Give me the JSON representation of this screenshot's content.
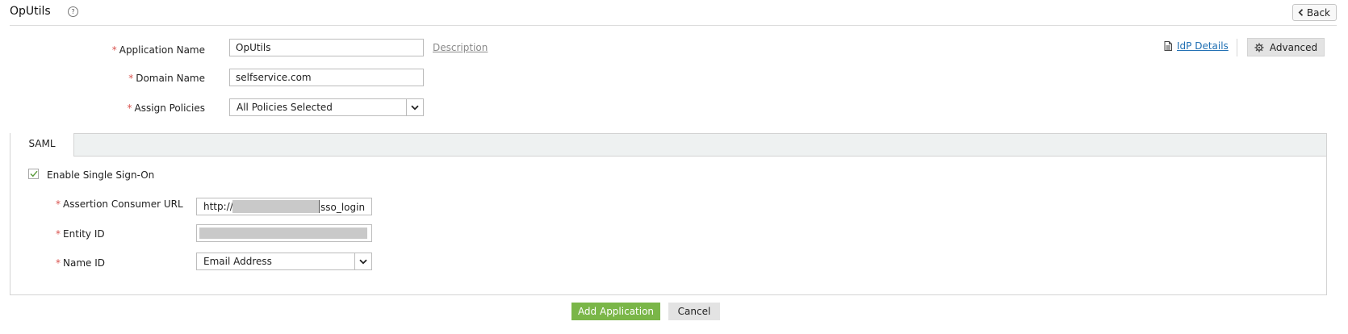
{
  "header": {
    "title": "OpUtils",
    "help_glyph": "?",
    "back_label": "Back"
  },
  "form": {
    "required_mark": "*",
    "application_name": {
      "label": "Application Name",
      "value": "OpUtils"
    },
    "description_link": "Description",
    "domain_name": {
      "label": "Domain Name",
      "value": "selfservice.com"
    },
    "assign_policies": {
      "label": "Assign Policies",
      "selected": "All Policies Selected"
    }
  },
  "top_actions": {
    "idp_details_label": "IdP Details",
    "advanced_label": "Advanced"
  },
  "saml": {
    "tab_label": "SAML",
    "enable_sso": {
      "label": "Enable Single Sign-On",
      "checked": true
    },
    "assertion_consumer_url": {
      "label": "Assertion Consumer URL",
      "value_prefix": "http://",
      "value_suffix": "sso_login"
    },
    "entity_id": {
      "label": "Entity ID"
    },
    "name_id": {
      "label": "Name ID",
      "selected": "Email Address"
    }
  },
  "footer": {
    "add_label": "Add Application",
    "cancel_label": "Cancel"
  },
  "colors": {
    "primary_button": "#7ab648",
    "link": "#1f6fb3",
    "required": "#d9534f",
    "redaction": "#c9c9c9"
  },
  "icons": {
    "help": "help-icon",
    "back": "chevron-left-icon",
    "idp": "document-icon",
    "advanced": "gear-icon",
    "dropdown": "chevron-down-icon",
    "checkbox": "checkmark-icon"
  }
}
